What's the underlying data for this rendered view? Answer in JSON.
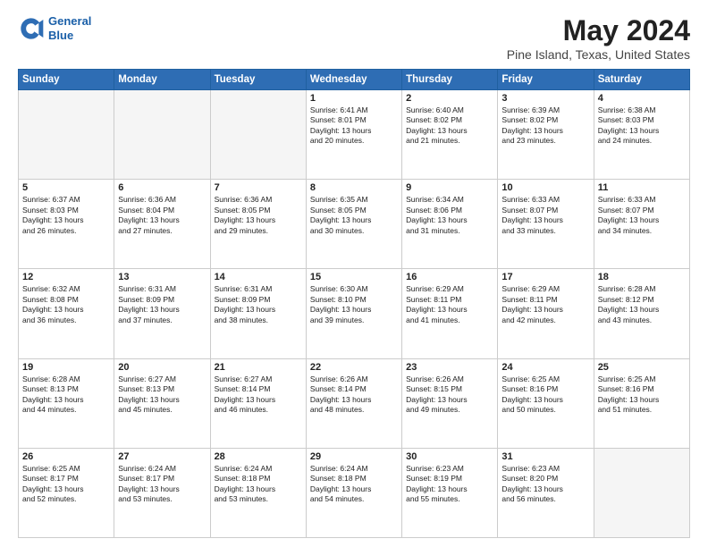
{
  "header": {
    "logo_line1": "General",
    "logo_line2": "Blue",
    "main_title": "May 2024",
    "subtitle": "Pine Island, Texas, United States"
  },
  "days_of_week": [
    "Sunday",
    "Monday",
    "Tuesday",
    "Wednesday",
    "Thursday",
    "Friday",
    "Saturday"
  ],
  "weeks": [
    [
      {
        "day": "",
        "info": ""
      },
      {
        "day": "",
        "info": ""
      },
      {
        "day": "",
        "info": ""
      },
      {
        "day": "1",
        "info": "Sunrise: 6:41 AM\nSunset: 8:01 PM\nDaylight: 13 hours\nand 20 minutes."
      },
      {
        "day": "2",
        "info": "Sunrise: 6:40 AM\nSunset: 8:02 PM\nDaylight: 13 hours\nand 21 minutes."
      },
      {
        "day": "3",
        "info": "Sunrise: 6:39 AM\nSunset: 8:02 PM\nDaylight: 13 hours\nand 23 minutes."
      },
      {
        "day": "4",
        "info": "Sunrise: 6:38 AM\nSunset: 8:03 PM\nDaylight: 13 hours\nand 24 minutes."
      }
    ],
    [
      {
        "day": "5",
        "info": "Sunrise: 6:37 AM\nSunset: 8:03 PM\nDaylight: 13 hours\nand 26 minutes."
      },
      {
        "day": "6",
        "info": "Sunrise: 6:36 AM\nSunset: 8:04 PM\nDaylight: 13 hours\nand 27 minutes."
      },
      {
        "day": "7",
        "info": "Sunrise: 6:36 AM\nSunset: 8:05 PM\nDaylight: 13 hours\nand 29 minutes."
      },
      {
        "day": "8",
        "info": "Sunrise: 6:35 AM\nSunset: 8:05 PM\nDaylight: 13 hours\nand 30 minutes."
      },
      {
        "day": "9",
        "info": "Sunrise: 6:34 AM\nSunset: 8:06 PM\nDaylight: 13 hours\nand 31 minutes."
      },
      {
        "day": "10",
        "info": "Sunrise: 6:33 AM\nSunset: 8:07 PM\nDaylight: 13 hours\nand 33 minutes."
      },
      {
        "day": "11",
        "info": "Sunrise: 6:33 AM\nSunset: 8:07 PM\nDaylight: 13 hours\nand 34 minutes."
      }
    ],
    [
      {
        "day": "12",
        "info": "Sunrise: 6:32 AM\nSunset: 8:08 PM\nDaylight: 13 hours\nand 36 minutes."
      },
      {
        "day": "13",
        "info": "Sunrise: 6:31 AM\nSunset: 8:09 PM\nDaylight: 13 hours\nand 37 minutes."
      },
      {
        "day": "14",
        "info": "Sunrise: 6:31 AM\nSunset: 8:09 PM\nDaylight: 13 hours\nand 38 minutes."
      },
      {
        "day": "15",
        "info": "Sunrise: 6:30 AM\nSunset: 8:10 PM\nDaylight: 13 hours\nand 39 minutes."
      },
      {
        "day": "16",
        "info": "Sunrise: 6:29 AM\nSunset: 8:11 PM\nDaylight: 13 hours\nand 41 minutes."
      },
      {
        "day": "17",
        "info": "Sunrise: 6:29 AM\nSunset: 8:11 PM\nDaylight: 13 hours\nand 42 minutes."
      },
      {
        "day": "18",
        "info": "Sunrise: 6:28 AM\nSunset: 8:12 PM\nDaylight: 13 hours\nand 43 minutes."
      }
    ],
    [
      {
        "day": "19",
        "info": "Sunrise: 6:28 AM\nSunset: 8:13 PM\nDaylight: 13 hours\nand 44 minutes."
      },
      {
        "day": "20",
        "info": "Sunrise: 6:27 AM\nSunset: 8:13 PM\nDaylight: 13 hours\nand 45 minutes."
      },
      {
        "day": "21",
        "info": "Sunrise: 6:27 AM\nSunset: 8:14 PM\nDaylight: 13 hours\nand 46 minutes."
      },
      {
        "day": "22",
        "info": "Sunrise: 6:26 AM\nSunset: 8:14 PM\nDaylight: 13 hours\nand 48 minutes."
      },
      {
        "day": "23",
        "info": "Sunrise: 6:26 AM\nSunset: 8:15 PM\nDaylight: 13 hours\nand 49 minutes."
      },
      {
        "day": "24",
        "info": "Sunrise: 6:25 AM\nSunset: 8:16 PM\nDaylight: 13 hours\nand 50 minutes."
      },
      {
        "day": "25",
        "info": "Sunrise: 6:25 AM\nSunset: 8:16 PM\nDaylight: 13 hours\nand 51 minutes."
      }
    ],
    [
      {
        "day": "26",
        "info": "Sunrise: 6:25 AM\nSunset: 8:17 PM\nDaylight: 13 hours\nand 52 minutes."
      },
      {
        "day": "27",
        "info": "Sunrise: 6:24 AM\nSunset: 8:17 PM\nDaylight: 13 hours\nand 53 minutes."
      },
      {
        "day": "28",
        "info": "Sunrise: 6:24 AM\nSunset: 8:18 PM\nDaylight: 13 hours\nand 53 minutes."
      },
      {
        "day": "29",
        "info": "Sunrise: 6:24 AM\nSunset: 8:18 PM\nDaylight: 13 hours\nand 54 minutes."
      },
      {
        "day": "30",
        "info": "Sunrise: 6:23 AM\nSunset: 8:19 PM\nDaylight: 13 hours\nand 55 minutes."
      },
      {
        "day": "31",
        "info": "Sunrise: 6:23 AM\nSunset: 8:20 PM\nDaylight: 13 hours\nand 56 minutes."
      },
      {
        "day": "",
        "info": ""
      }
    ]
  ]
}
